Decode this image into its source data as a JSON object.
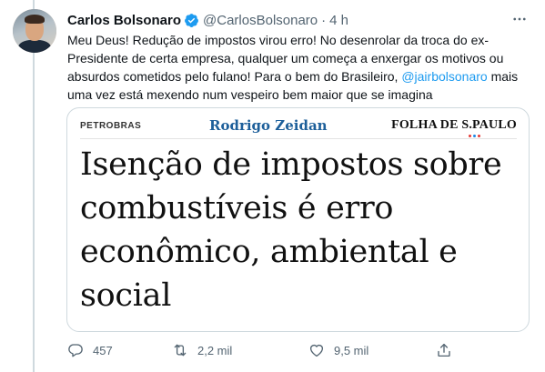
{
  "tweet": {
    "author_name": "Carlos Bolsonaro",
    "handle": "@CarlosBolsonaro",
    "separator": "·",
    "timestamp": "4 h",
    "text_before_mention": "Meu Deus! Redução de impostos virou erro! No desenrolar da troca do ex-Presidente de certa empresa, qualquer um começa a enxergar os motivos ou absurdos cometidos pelo fulano! Para o bem do Brasileiro, ",
    "mention": "@jairbolsonaro",
    "text_after_mention": " mais uma vez está mexendo num vespeiro bem maior que se imagina",
    "icons": {
      "verified": "verified-badge-icon",
      "more": "more-options-icon"
    }
  },
  "media": {
    "section": "PETROBRAS",
    "columnist": "Rodrigo Zeidan",
    "brand": "FOLHA DE S.PAULO",
    "headline": "Isenção de impostos sobre combustíveis é erro econômico, ambiental e social"
  },
  "actions": {
    "reply_count": "457",
    "retweet_count": "2,2 mil",
    "like_count": "9,5 mil",
    "icons": [
      "reply-icon",
      "retweet-icon",
      "like-icon",
      "share-icon"
    ]
  },
  "colors": {
    "accent": "#1d9bf0",
    "text": "#0f1419",
    "secondary": "#536471",
    "border": "#cfd9de"
  }
}
